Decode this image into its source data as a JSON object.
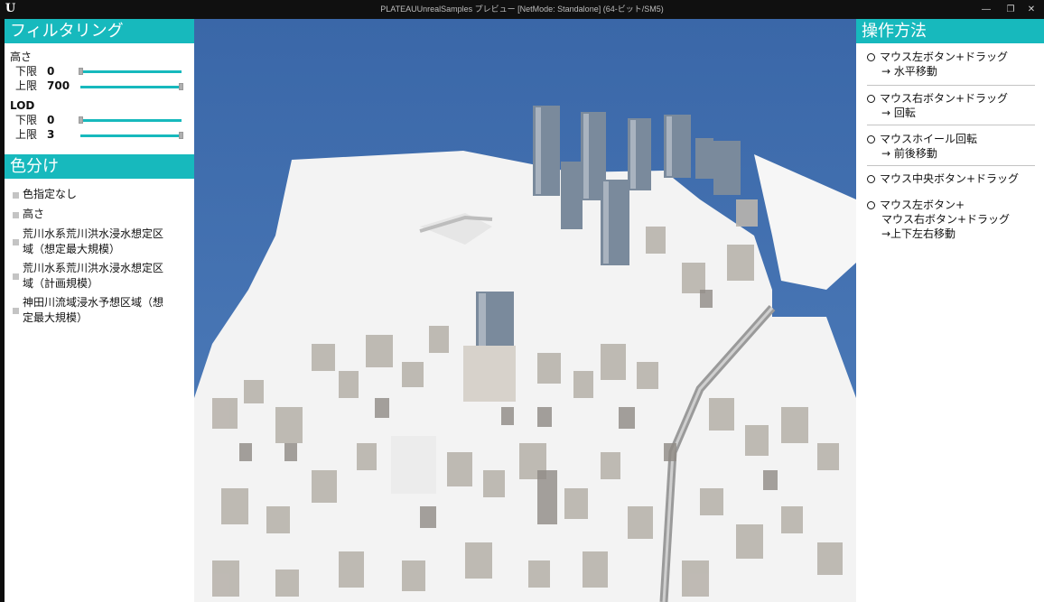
{
  "window": {
    "title": "PLATEAUUnrealSamples プレビュー [NetMode: Standalone]  (64-ビット/SM5)",
    "minimize_icon": "minimize-icon",
    "restore_icon": "restore-icon",
    "close_icon": "close-icon"
  },
  "filtering": {
    "title": "フィルタリング",
    "height": {
      "label": "高さ",
      "lower_label": "下限",
      "lower_value": "0",
      "upper_label": "上限",
      "upper_value": "700",
      "range_min": 0,
      "range_max": 700,
      "lower_fraction": 0.0,
      "upper_fraction": 1.0
    },
    "lod": {
      "label": "LOD",
      "lower_label": "下限",
      "lower_value": "0",
      "upper_label": "上限",
      "upper_value": "3",
      "lower_fraction": 0.0,
      "upper_fraction": 1.0
    }
  },
  "color_coding": {
    "title": "色分け",
    "options": [
      {
        "line1": "色指定なし",
        "line2": ""
      },
      {
        "line1": "高さ",
        "line2": ""
      },
      {
        "line1": "荒川水系荒川洪水浸水想定区",
        "line2": "域（想定最大規模）"
      },
      {
        "line1": "荒川水系荒川洪水浸水想定区",
        "line2": "域（計画規模）"
      },
      {
        "line1": "神田川流域浸水予想区域（想",
        "line2": "定最大規模）"
      }
    ]
  },
  "controls": {
    "title": "操作方法",
    "items": [
      {
        "line1": "マウス左ボタン+ドラッグ",
        "line2": "→ 水平移動",
        "line3": ""
      },
      {
        "line1": "マウス右ボタン+ドラッグ",
        "line2": "→ 回転",
        "line3": ""
      },
      {
        "line1": "マウスホイール回転",
        "line2": "→ 前後移動",
        "line3": ""
      },
      {
        "line1": "マウス中央ボタン+ドラッグ",
        "line2": "",
        "line3": ""
      },
      {
        "line1": "マウス左ボタン+",
        "line2": "マウス右ボタン+ドラッグ",
        "line3": "→上下左右移動"
      }
    ]
  },
  "colors": {
    "accent": "#17b9bd",
    "sky": "#3f6fb0",
    "ground": "#f2f2f2"
  }
}
